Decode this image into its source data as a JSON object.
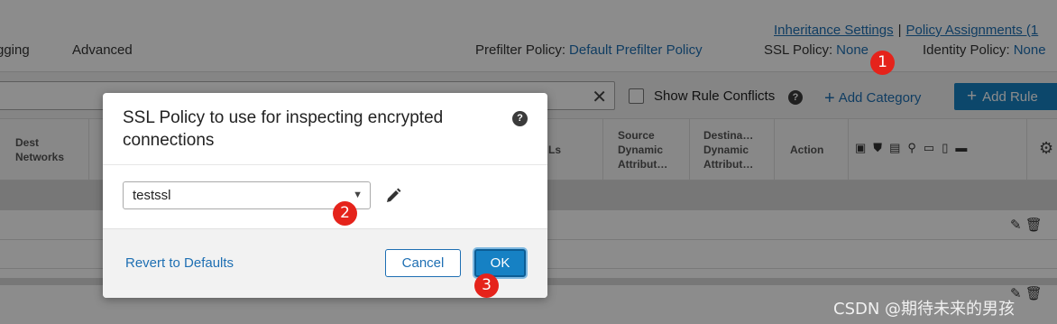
{
  "header": {
    "top_links": [
      "Inheritance Settings",
      "Policy Assignments (1"
    ],
    "tabs": [
      "gging",
      "Advanced"
    ],
    "prefilter_label": "Prefilter Policy:",
    "prefilter_value": "Default Prefilter Policy",
    "ssl_label": "SSL Policy:",
    "ssl_value": "None",
    "identity_label": "Identity Policy:",
    "identity_value": "None"
  },
  "toolbar": {
    "show_conflicts_label": "Show Rule Conflicts",
    "add_category_label": "Add Category",
    "add_rule_label": "Add Rule"
  },
  "table": {
    "columns": [
      "Dest Networks",
      "Ls",
      "Source Dynamic Attribut…",
      "Destina… Dynamic Attribut…",
      "Action"
    ],
    "column_lines": {
      "dest_networks": [
        "Dest",
        "Networks"
      ],
      "source_dynamic": [
        "Source",
        "Dynamic",
        "Attribut…"
      ],
      "dest_dynamic": [
        "Destina…",
        "Dynamic",
        "Attribut…"
      ]
    }
  },
  "modal": {
    "title": "SSL Policy to use for inspecting encrypted connections",
    "selected_policy": "testssl",
    "revert_label": "Revert to Defaults",
    "cancel_label": "Cancel",
    "ok_label": "OK"
  },
  "annotations": [
    "1",
    "2",
    "3"
  ],
  "watermark": "CSDN @期待未来的男孩",
  "colors": {
    "link": "#1e6fb3",
    "primary_button": "#1681c4",
    "annotation": "#e5231b"
  }
}
